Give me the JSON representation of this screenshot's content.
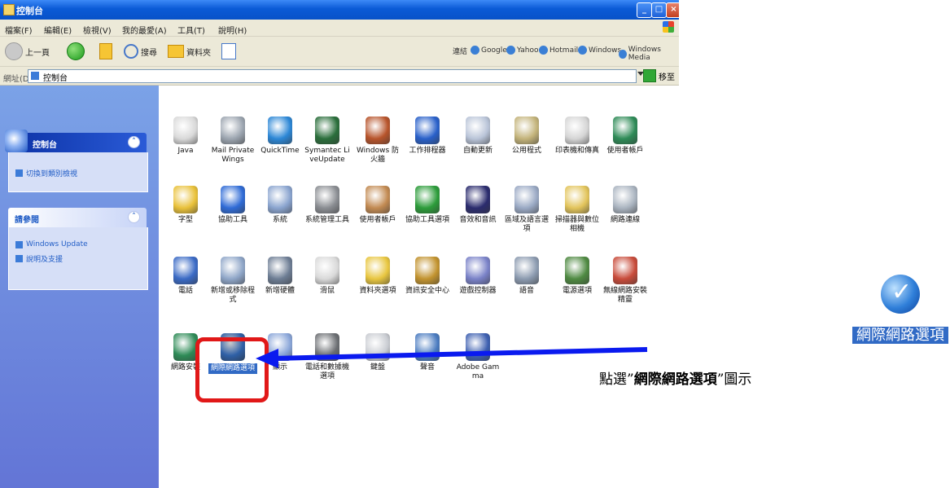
{
  "window": {
    "title": "控制台",
    "menu": [
      "檔案(F)",
      "編輯(E)",
      "檢視(V)",
      "我的最愛(A)",
      "工具(T)",
      "說明(H)"
    ],
    "toolbar": {
      "back": "上一頁",
      "search": "搜尋",
      "folders": "資料夾",
      "links": [
        "連結",
        "Google",
        "Yahoo",
        "Hotmail",
        "Windows",
        "Windows Media"
      ]
    },
    "address": {
      "label": "網址(D)",
      "value": "控制台",
      "go": "移至"
    }
  },
  "task_pane": {
    "control_panel": {
      "title": "控制台",
      "link": "切換到類別檢視"
    },
    "see_also": {
      "title": "請參閱",
      "links": [
        "Windows Update",
        "說明及支援"
      ]
    }
  },
  "icons": [
    [
      {
        "label": "Java",
        "color": "#d9d9d9"
      },
      {
        "label": "Mail PrivateWings",
        "color": "#9ca5b0"
      },
      {
        "label": "QuickTime",
        "color": "#2c87d6"
      },
      {
        "label": "Symantec LiveUpdate",
        "color": "#2a6e3b"
      },
      {
        "label": "Windows 防火牆",
        "color": "#b7542b"
      },
      {
        "label": "工作排程器",
        "color": "#2960c9"
      },
      {
        "label": "自動更新",
        "color": "#b9c4d8"
      },
      {
        "label": "公用程式",
        "color": "#c3b37a"
      },
      {
        "label": "印表機和傳真",
        "color": "#d5d5d5"
      },
      {
        "label": "使用者帳戶",
        "color": "#2e8b57"
      }
    ],
    [
      {
        "label": "字型",
        "color": "#e9c13a"
      },
      {
        "label": "協助工具",
        "color": "#2f6bd6"
      },
      {
        "label": "系統",
        "color": "#8aa4cf"
      },
      {
        "label": "系統管理工具",
        "color": "#8a8d92"
      },
      {
        "label": "使用者帳戶",
        "color": "#c28a52"
      },
      {
        "label": "協助工具選項",
        "color": "#2c9c3a"
      },
      {
        "label": "音效和音訊",
        "color": "#2b2c6e"
      },
      {
        "label": "區域及語言選項",
        "color": "#9aa9c4"
      },
      {
        "label": "掃描器與數位相機",
        "color": "#e2c45b"
      },
      {
        "label": "網路連線",
        "color": "#aab4c0"
      }
    ],
    [
      {
        "label": "電話",
        "color": "#3a6ac5"
      },
      {
        "label": "新增或移除程式",
        "color": "#8fa6c8"
      },
      {
        "label": "新增硬體",
        "color": "#6d7d94"
      },
      {
        "label": "滑鼠",
        "color": "#d9d9d9"
      },
      {
        "label": "資料夾選項",
        "color": "#e8c640"
      },
      {
        "label": "資訊安全中心",
        "color": "#c2932f"
      },
      {
        "label": "遊戲控制器",
        "color": "#7a82c8"
      },
      {
        "label": "語音",
        "color": "#8c9bb0"
      },
      {
        "label": "電源選項",
        "color": "#4f8a42"
      },
      {
        "label": "無線網路安裝精靈",
        "color": "#c84b3a"
      }
    ],
    [
      {
        "label": "網路安裝",
        "color": "#2e8b57"
      },
      {
        "label": "網際網路選項",
        "color": "#3a78d0"
      },
      {
        "label": "顯示",
        "color": "#8aa6d9"
      },
      {
        "label": "電話和數據機選項",
        "color": "#6b6e72"
      },
      {
        "label": "鍵盤",
        "color": "#c9ccd2"
      },
      {
        "label": "聲音",
        "color": "#4a7bc0"
      },
      {
        "label": "Adobe Gamma",
        "color": "#3d5fb0"
      }
    ]
  ],
  "annotation": {
    "caption_prefix": "點選”",
    "caption_bold": "網際網路選項",
    "caption_suffix": "”圖示",
    "zoom_label": "網際網路選項"
  },
  "colors": {
    "arrow": "#0a1aef",
    "highlight": "#e11818",
    "selection": "#316ac5"
  }
}
